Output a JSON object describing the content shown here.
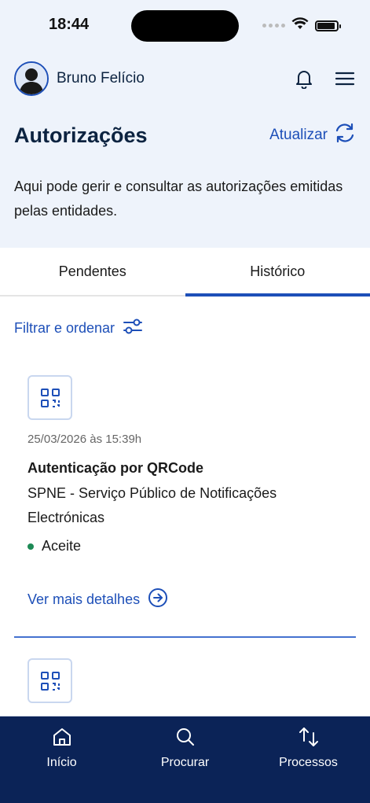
{
  "status_bar": {
    "time": "18:44",
    "battery_level": 0.9
  },
  "header": {
    "user_name": "Bruno Felício",
    "notifications_icon": "bell-icon",
    "menu_icon": "hamburger-menu-icon"
  },
  "page": {
    "title": "Autorizações",
    "refresh_label": "Atualizar",
    "description": "Aqui pode gerir e consultar as autorizações emitidas pelas entidades."
  },
  "tabs": [
    {
      "label": "Pendentes",
      "active": false
    },
    {
      "label": "Histórico",
      "active": true
    }
  ],
  "filter": {
    "label": "Filtrar e ordenar"
  },
  "authorizations": [
    {
      "icon": "qr-code-icon",
      "date": "25/03/2026 às 15:39h",
      "title": "Autenticação por QRCode",
      "entity": "SPNE - Serviço Público de Notificações Electrónicas",
      "status": "Aceite",
      "status_color": "#1d8a55",
      "details_label": "Ver mais detalhes"
    },
    {
      "icon": "qr-code-icon"
    }
  ],
  "bottom_nav": [
    {
      "label": "Início",
      "icon": "home-icon"
    },
    {
      "label": "Procurar",
      "icon": "search-icon"
    },
    {
      "label": "Processos",
      "icon": "arrows-up-down-icon"
    }
  ],
  "colors": {
    "accent": "#1d4fb8",
    "navy": "#0b2357",
    "header_bg": "#eef3fb"
  }
}
